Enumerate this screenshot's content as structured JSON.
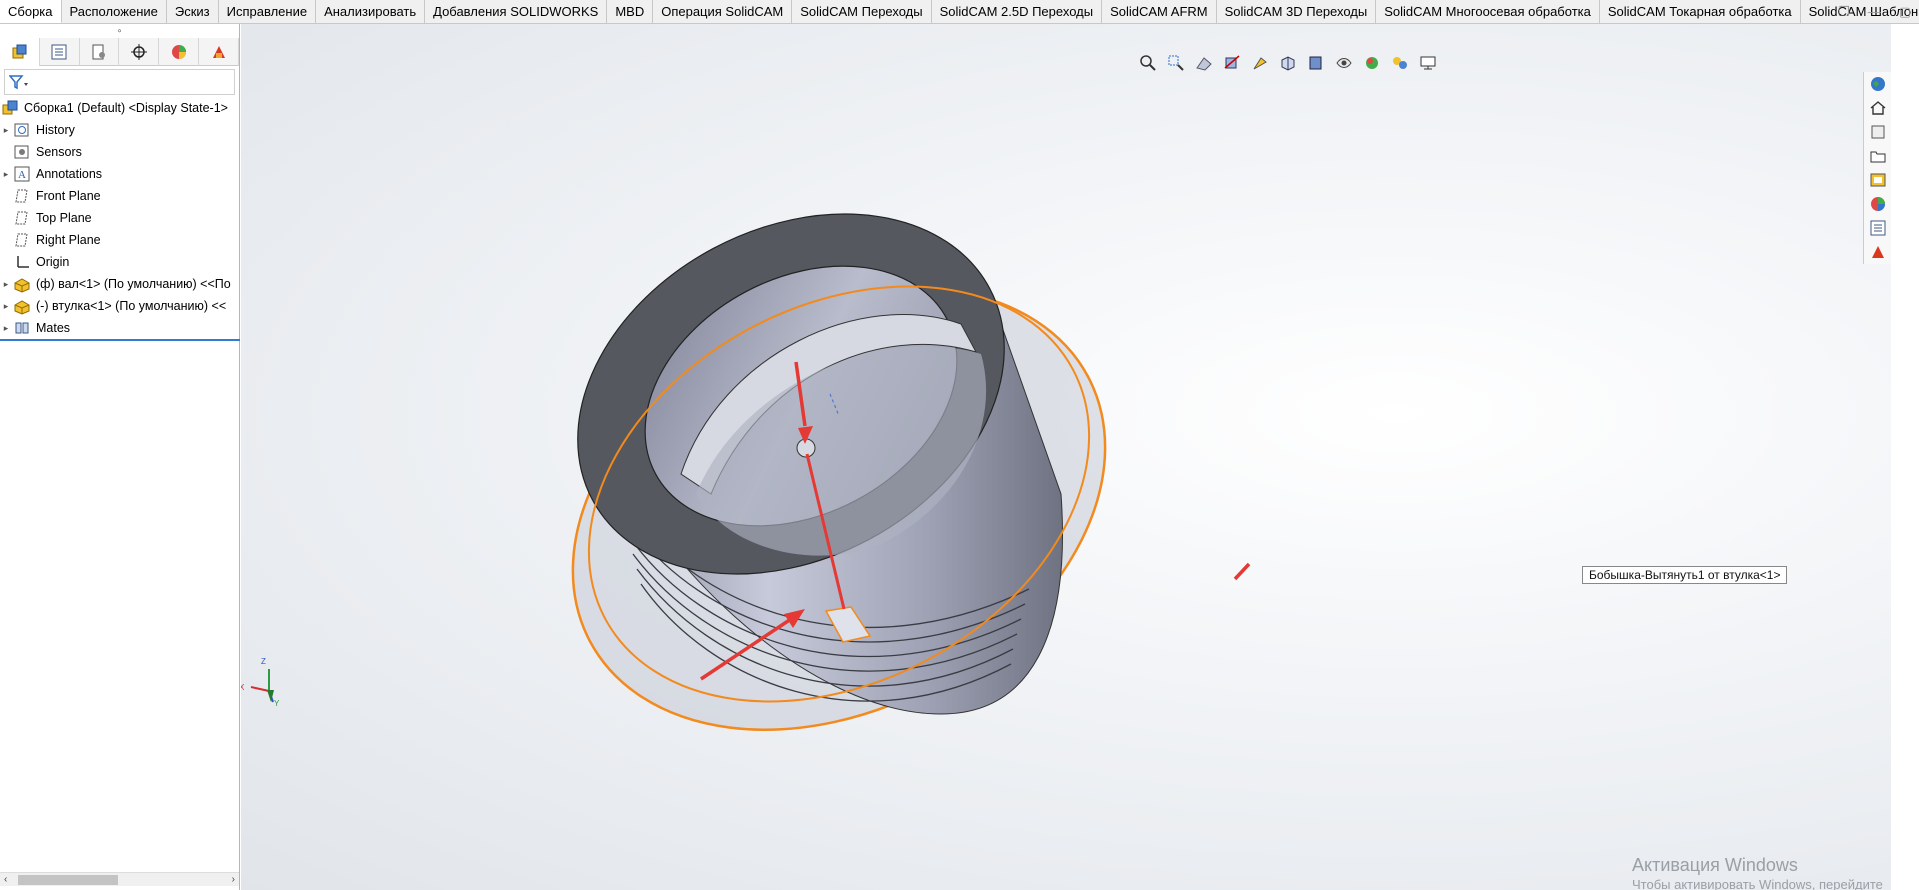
{
  "tabs": [
    {
      "label": "Сборка",
      "active": true
    },
    {
      "label": "Расположение"
    },
    {
      "label": "Эскиз"
    },
    {
      "label": "Исправление"
    },
    {
      "label": "Анализировать"
    },
    {
      "label": "Добавления SOLIDWORKS"
    },
    {
      "label": "MBD"
    },
    {
      "label": "Операция  SolidCAM"
    },
    {
      "label": "SolidCAM Переходы"
    },
    {
      "label": "SolidCAM 2.5D Переходы"
    },
    {
      "label": "SolidCAM AFRM"
    },
    {
      "label": "SolidCAM 3D Переходы"
    },
    {
      "label": "SolidCAM Многоосевая обработка"
    },
    {
      "label": "SolidCAM Токарная обработка"
    },
    {
      "label": "SolidCAM Шаблоны"
    }
  ],
  "feature_tree": {
    "root": "Сборка1 (Default) <Display State-1>",
    "items": [
      {
        "label": "History",
        "icon": "history-icon",
        "expandable": true
      },
      {
        "label": "Sensors",
        "icon": "sensors-icon",
        "expandable": false
      },
      {
        "label": "Annotations",
        "icon": "annotations-icon",
        "expandable": true
      },
      {
        "label": "Front Plane",
        "icon": "plane-icon",
        "expandable": false
      },
      {
        "label": "Top Plane",
        "icon": "plane-icon",
        "expandable": false
      },
      {
        "label": "Right Plane",
        "icon": "plane-icon",
        "expandable": false
      },
      {
        "label": "Origin",
        "icon": "origin-icon",
        "expandable": false
      },
      {
        "label": "(ф) вал<1> (По умолчанию) <<По",
        "icon": "part-icon",
        "expandable": true
      },
      {
        "label": "(-) втулка<1> (По умолчанию) <<",
        "icon": "part-icon",
        "expandable": true
      },
      {
        "label": "Mates",
        "icon": "mates-icon",
        "expandable": true
      }
    ]
  },
  "viewport": {
    "tooltip": "Бобышка-Вытянуть1 от втулка<1>",
    "triad": {
      "x": "X",
      "y": "Y",
      "z": "Z"
    }
  },
  "activation": {
    "title": "Активация Windows",
    "subtitle": "Чтобы активировать Windows, перейдите в раздел \"Параметры\"."
  },
  "colors": {
    "selection": "#f28a1e",
    "arrow": "#e53935",
    "part_face": "#5a5d66",
    "part_body": "#a9adbd"
  }
}
